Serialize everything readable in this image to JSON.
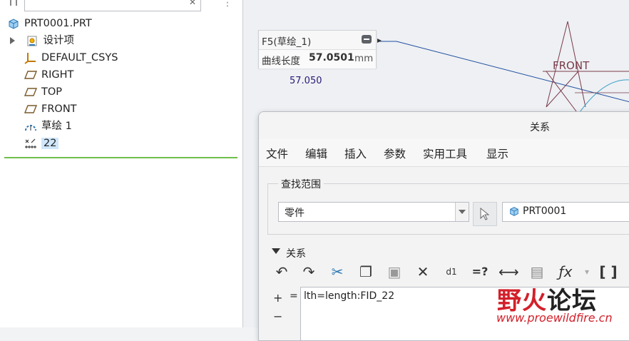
{
  "tree": {
    "items": [
      {
        "label": "PRT0001.PRT",
        "icon": "part-icon"
      },
      {
        "label": "设计项",
        "icon": "design-items-icon"
      },
      {
        "label": "DEFAULT_CSYS",
        "icon": "csys-icon"
      },
      {
        "label": "RIGHT",
        "icon": "datum-plane-icon"
      },
      {
        "label": "TOP",
        "icon": "datum-plane-icon"
      },
      {
        "label": "FRONT",
        "icon": "datum-plane-icon"
      },
      {
        "label": "草绘 1",
        "icon": "sketch-icon"
      },
      {
        "label": "22",
        "icon": "analysis-icon"
      }
    ]
  },
  "tooltip": {
    "title": "F5(草绘_1)",
    "label": "曲线长度",
    "value": "57.0501",
    "unit": "mm"
  },
  "graphics": {
    "dim_text": "57.050",
    "plane_label": "FRONT"
  },
  "dialog": {
    "title": "关系",
    "menus": [
      "文件",
      "编辑",
      "插入",
      "参数",
      "实用工具",
      "显示"
    ],
    "scope": {
      "legend": "查找范围",
      "selected": "零件",
      "part": "PRT0001"
    },
    "relations": {
      "heading": "关系",
      "plus": "+",
      "minus": "−",
      "equals": "=",
      "text": "lth=length:FID_22"
    }
  },
  "watermark": {
    "part1": "野火",
    "part2": "论坛",
    "url": "www.proewildfire.cn"
  },
  "colors": {
    "selection": "#cfe6fb",
    "separator": "#6fbf4a",
    "dim_text": "#2a1a77",
    "watermark_red": "#d3202a"
  }
}
